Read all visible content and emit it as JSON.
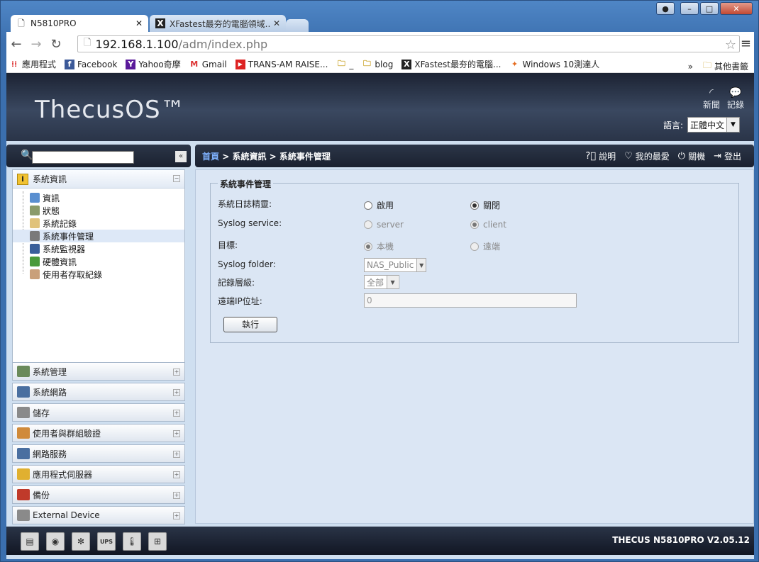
{
  "browser": {
    "tabs": [
      {
        "title": "N5810PRO"
      },
      {
        "title": "XFastest最夯的電腦領域..."
      }
    ],
    "url_host": "192.168.1.100",
    "url_path": "/adm/index.php",
    "bookmarks": [
      {
        "label": "應用程式"
      },
      {
        "label": "Facebook"
      },
      {
        "label": "Yahoo奇摩"
      },
      {
        "label": "Gmail"
      },
      {
        "label": "TRANS-AM RAISE..."
      },
      {
        "label": "_"
      },
      {
        "label": "blog"
      },
      {
        "label": "XFastest最夯的電腦..."
      },
      {
        "label": "Windows 10測達人"
      }
    ],
    "other_bookmarks": "其他書籤",
    "overflow": "»"
  },
  "header": {
    "logo": "ThecusOS™",
    "news_label": "新聞",
    "log_label": "記錄",
    "lang_label": "語言:",
    "lang_value": "正體中文"
  },
  "breadcrumb": {
    "home": "首頁",
    "sep1": " > ",
    "section": "系統資訊",
    "sep2": " > ",
    "page": "系統事件管理"
  },
  "toolbar": {
    "help": "說明",
    "favorites": "我的最愛",
    "shutdown": "關機",
    "logout": "登出"
  },
  "sidebar": {
    "section_title": "系統資訊",
    "items": [
      {
        "label": "資訊"
      },
      {
        "label": "狀態"
      },
      {
        "label": "系統記錄"
      },
      {
        "label": "系統事件管理"
      },
      {
        "label": "系統監視器"
      },
      {
        "label": "硬體資訊"
      },
      {
        "label": "使用者存取紀錄"
      }
    ],
    "accordion": [
      {
        "label": "系統管理"
      },
      {
        "label": "系統網路"
      },
      {
        "label": "儲存"
      },
      {
        "label": "使用者與群組驗證"
      },
      {
        "label": "網路服務"
      },
      {
        "label": "應用程式伺服器"
      },
      {
        "label": "備份"
      },
      {
        "label": "External Device"
      }
    ]
  },
  "form": {
    "legend": "系統事件管理",
    "daemon_label": "系統日誌精靈:",
    "daemon_on": "啟用",
    "daemon_off": "關閉",
    "service_label": "Syslog service:",
    "service_server": "server",
    "service_client": "client",
    "target_label": "目標:",
    "target_local": "本機",
    "target_remote": "遠端",
    "folder_label": "Syslog folder:",
    "folder_value": "NAS_Public",
    "level_label": "記錄層級:",
    "level_value": "全部",
    "ip_label": "遠端IP位址:",
    "ip_value": "0",
    "apply": "執行"
  },
  "footer": {
    "version": "THECUS N5810PRO V2.05.12"
  }
}
